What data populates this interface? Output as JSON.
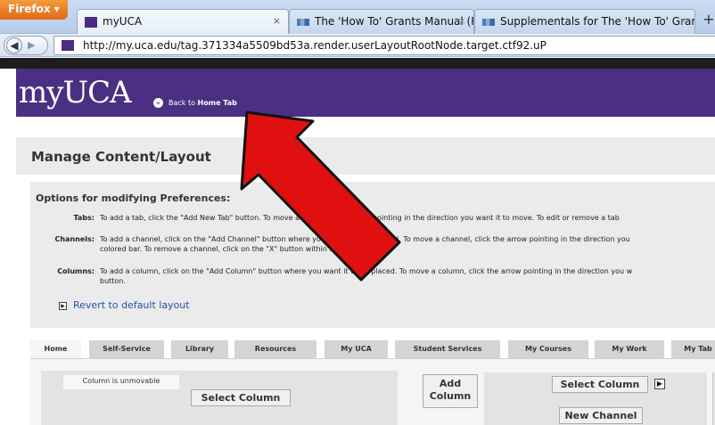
{
  "browser": {
    "menu_label": "Firefox ▾",
    "tabs": [
      {
        "title": "myUCA",
        "close": "×"
      },
      {
        "title": "The 'How To' Grants Manual (Rowma...",
        "close": "×"
      },
      {
        "title": "Supplementals for The 'How To' Gran...",
        "close": "×"
      }
    ],
    "new_tab": "+",
    "url": "http://my.uca.edu/tag.371334a5509bd53a.render.userLayoutRootNode.target.ctf92.uP"
  },
  "header": {
    "logo": "myUCA",
    "back_prefix": "Back to ",
    "back_target": "Home Tab"
  },
  "page": {
    "title": "Manage Content/Layout"
  },
  "options": {
    "heading": "Options for modifying Preferences:",
    "rows": [
      {
        "label": "Tabs:",
        "lines": [
          "To add a tab, click the \"Add New Tab\" button. To move a tab, click the arrow pointing in the direction you want it to move. To edit or remove a tab"
        ]
      },
      {
        "label": "Channels:",
        "lines": [
          "To add a channel, click on the \"Add Channel\" button where you want it to be placed. To move a channel, click the arrow pointing in the direction you",
          "colored bar. To remove a channel, click on the \"X\" button within its colored bar."
        ]
      },
      {
        "label": "Columns:",
        "lines": [
          "To add a column, click on the \"Add Column\" button where you want it to be placed. To move a column, click the arrow pointing in the direction you w",
          "button."
        ]
      }
    ],
    "revert_label": "Revert to default layout"
  },
  "layout_tabs": [
    "Home",
    "Self-Service",
    "Library",
    "Resources",
    "My UCA",
    "Student Services",
    "My Courses",
    "My Work",
    "My Tab"
  ],
  "layout": {
    "unmovable": "Column is unmovable",
    "select_column": "Select Column",
    "add_column_l1": "Add",
    "add_column_l2": "Column",
    "new_channel": "New Channel"
  },
  "colors": {
    "brand_purple": "#4b2f82",
    "annotation_arrow": "#e01010"
  }
}
